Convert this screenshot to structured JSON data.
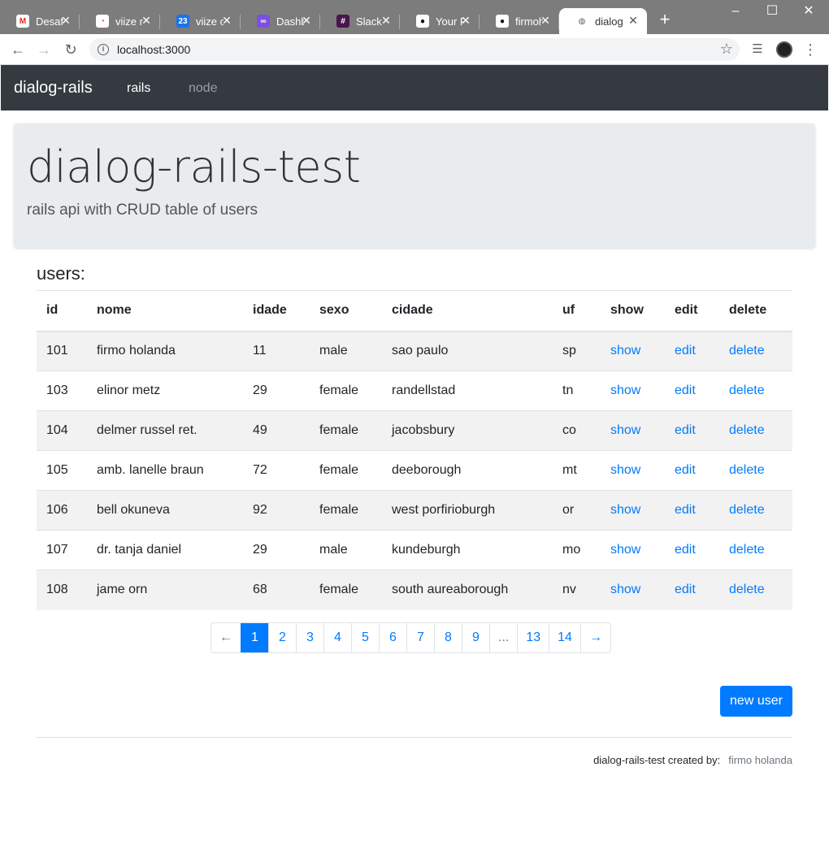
{
  "browser": {
    "tabs": [
      {
        "title": "Desafio",
        "icon": "gmail-icon",
        "favicon_text": "M",
        "favicon_color": "#d93025",
        "favicon_bg": "#ffffff"
      },
      {
        "title": "viize re",
        "icon": "viize-icon",
        "favicon_text": "◔",
        "favicon_color": "#e8453c",
        "favicon_bg": "#ffffff"
      },
      {
        "title": "viize cal",
        "icon": "calendar-icon",
        "favicon_text": "23",
        "favicon_color": "#ffffff",
        "favicon_bg": "#1a73e8"
      },
      {
        "title": "Dashboard",
        "icon": "dashboard-icon",
        "favicon_text": "∞",
        "favicon_color": "#ffffff",
        "favicon_bg": "#7b4fe0"
      },
      {
        "title": "Slack",
        "icon": "slack-icon",
        "favicon_text": "#",
        "favicon_color": "#ffffff",
        "favicon_bg": "#4a154b"
      },
      {
        "title": "Your R",
        "icon": "github-icon",
        "favicon_text": "●",
        "favicon_color": "#000000",
        "favicon_bg": "#ffffff"
      },
      {
        "title": "firmoh",
        "icon": "github-icon",
        "favicon_text": "●",
        "favicon_color": "#000000",
        "favicon_bg": "#ffffff"
      },
      {
        "title": "dialog-",
        "icon": "globe-icon",
        "favicon_text": "◍",
        "favicon_color": "#5f6368",
        "favicon_bg": "#ffffff"
      }
    ],
    "url": "localhost:3000"
  },
  "navbar": {
    "brand": "dialog-rails",
    "links": [
      {
        "label": "rails",
        "active": true
      },
      {
        "label": "node",
        "active": false
      }
    ]
  },
  "jumbotron": {
    "title": "dialog-rails-test",
    "subtitle": "rails api with CRUD table of users"
  },
  "users": {
    "heading": "users:",
    "columns": [
      "id",
      "nome",
      "idade",
      "sexo",
      "cidade",
      "uf",
      "show",
      "edit",
      "delete"
    ],
    "rows": [
      {
        "id": "101",
        "nome": "firmo holanda",
        "idade": "11",
        "sexo": "male",
        "cidade": "sao paulo",
        "uf": "sp",
        "show": "show",
        "edit": "edit",
        "delete": "delete"
      },
      {
        "id": "103",
        "nome": "elinor metz",
        "idade": "29",
        "sexo": "female",
        "cidade": "randellstad",
        "uf": "tn",
        "show": "show",
        "edit": "edit",
        "delete": "delete"
      },
      {
        "id": "104",
        "nome": "delmer russel ret.",
        "idade": "49",
        "sexo": "female",
        "cidade": "jacobsbury",
        "uf": "co",
        "show": "show",
        "edit": "edit",
        "delete": "delete"
      },
      {
        "id": "105",
        "nome": "amb. lanelle braun",
        "idade": "72",
        "sexo": "female",
        "cidade": "deeborough",
        "uf": "mt",
        "show": "show",
        "edit": "edit",
        "delete": "delete"
      },
      {
        "id": "106",
        "nome": "bell okuneva",
        "idade": "92",
        "sexo": "female",
        "cidade": "west porfirioburgh",
        "uf": "or",
        "show": "show",
        "edit": "edit",
        "delete": "delete"
      },
      {
        "id": "107",
        "nome": "dr. tanja daniel",
        "idade": "29",
        "sexo": "male",
        "cidade": "kundeburgh",
        "uf": "mo",
        "show": "show",
        "edit": "edit",
        "delete": "delete"
      },
      {
        "id": "108",
        "nome": "jame orn",
        "idade": "68",
        "sexo": "female",
        "cidade": "south aureaborough",
        "uf": "nv",
        "show": "show",
        "edit": "edit",
        "delete": "delete"
      }
    ]
  },
  "pagination": {
    "prev": "←",
    "next": "→",
    "pages": [
      "1",
      "2",
      "3",
      "4",
      "5",
      "6",
      "7",
      "8",
      "9",
      "...",
      "13",
      "14"
    ],
    "current": "1"
  },
  "actions": {
    "new_user": "new user"
  },
  "footer": {
    "text": "dialog-rails-test created by:",
    "author": "firmo holanda"
  },
  "colors": {
    "navbar_bg": "#343a40",
    "jumbotron_bg": "#e9ecef",
    "primary": "#007bff",
    "stripe": "#f2f2f2"
  }
}
